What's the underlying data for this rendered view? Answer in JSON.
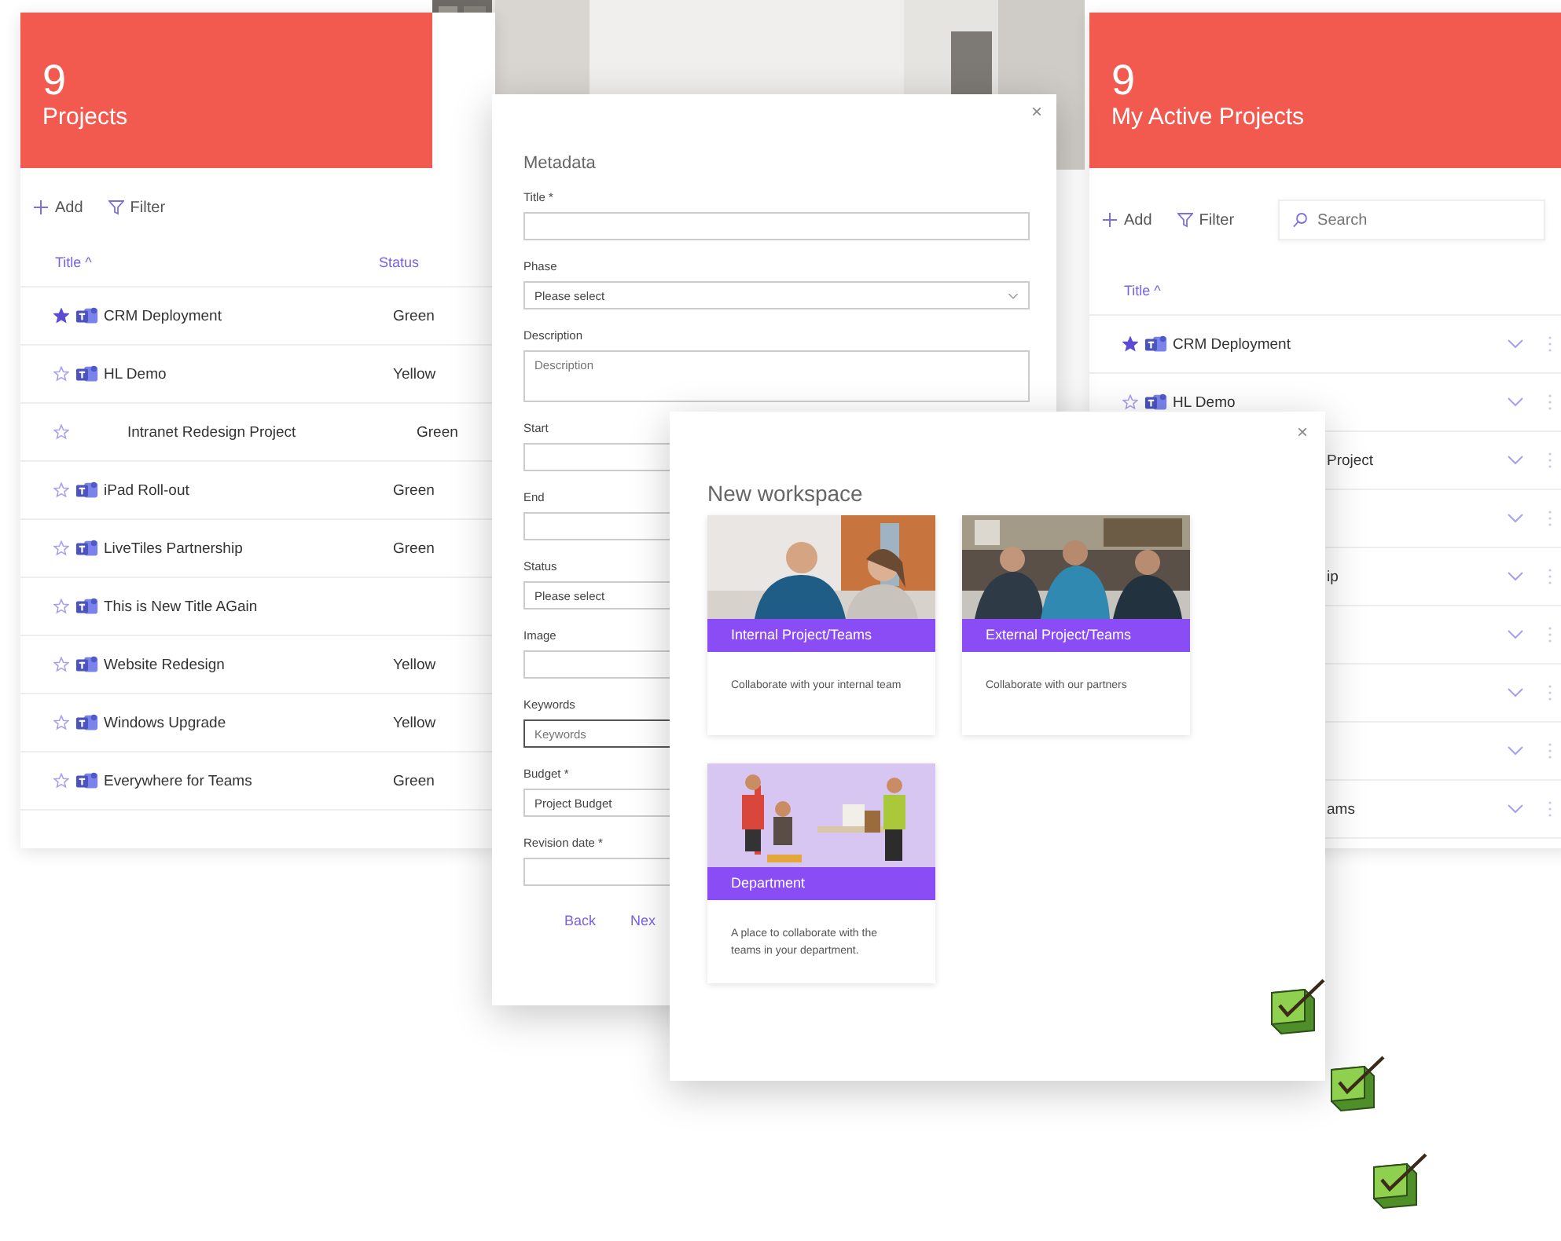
{
  "projects_panel": {
    "count": "9",
    "title": "Projects",
    "toolbar": [
      {
        "kind": "add",
        "label": "Add"
      },
      {
        "kind": "filter",
        "label": "Filter"
      }
    ],
    "columns": [
      "Title ^",
      "Status"
    ],
    "rows": [
      {
        "favorite": true,
        "teams": true,
        "title": "CRM Deployment",
        "status": "Green"
      },
      {
        "favorite": false,
        "teams": true,
        "title": "HL Demo",
        "status": "Yellow"
      },
      {
        "favorite": false,
        "teams": false,
        "title": "Intranet Redesign Project",
        "status": "Green"
      },
      {
        "favorite": false,
        "teams": true,
        "title": "iPad Roll-out",
        "status": "Green"
      },
      {
        "favorite": false,
        "teams": true,
        "title": "LiveTiles Partnership",
        "status": "Green"
      },
      {
        "favorite": false,
        "teams": true,
        "title": "This is New Title AGain"
      },
      {
        "favorite": false,
        "teams": true,
        "title": "Website Redesign",
        "status": "Yellow"
      },
      {
        "favorite": false,
        "teams": true,
        "title": "Windows Upgrade",
        "status": "Yellow"
      },
      {
        "favorite": false,
        "teams": true,
        "title": "Everywhere for Teams",
        "status": "Green"
      }
    ]
  },
  "active_panel": {
    "count": "9",
    "title": "My Active Projects",
    "toolbar": [
      {
        "kind": "add",
        "label": "Add"
      },
      {
        "kind": "filter",
        "label": "Filter"
      }
    ],
    "search": {
      "placeholder": "Search"
    },
    "columns": [
      "Title ^"
    ],
    "rows": [
      {
        "favorite": true,
        "teams": true,
        "title": "CRM Deployment",
        "expanded": false
      },
      {
        "favorite": false,
        "teams": true,
        "title": "HL Demo",
        "expanded": false
      },
      {
        "tail": "Project",
        "expanded": false
      },
      {
        "expanded": false
      },
      {
        "tail": "ip",
        "expanded": false
      },
      {
        "expanded": false
      },
      {
        "expanded": false
      },
      {
        "expanded": false
      },
      {
        "tail": "ams",
        "expanded": false
      }
    ]
  },
  "metadata_dialog": {
    "close": "×",
    "title": "Metadata",
    "fields": [
      {
        "kind": "text",
        "label": "Title *",
        "focused": false
      },
      {
        "kind": "select",
        "label": "Phase",
        "value": "Please select",
        "focused": false
      },
      {
        "kind": "textarea",
        "label": "Description",
        "placeholder": "Description",
        "focused": false
      },
      {
        "kind": "text",
        "label": "Start",
        "focused": false
      },
      {
        "kind": "text",
        "label": "End",
        "focused": false
      },
      {
        "kind": "select",
        "label": "Status",
        "value": "Please select",
        "focused": false
      },
      {
        "kind": "text",
        "label": "Image",
        "focused": false
      },
      {
        "kind": "text",
        "label": "Keywords",
        "placeholder": "Keywords",
        "focused": true
      },
      {
        "kind": "text",
        "label": "Budget *",
        "value": "Project Budget",
        "focused": false
      },
      {
        "kind": "text",
        "label": "Revision date *",
        "focused": false
      }
    ],
    "buttons": [
      "Back",
      "Nex"
    ]
  },
  "workspace_dialog": {
    "close": "×",
    "title": "New workspace",
    "cards": [
      {
        "title": "Internal Project/Teams",
        "description": "Collaborate with your internal team"
      },
      {
        "title": "External Project/Teams",
        "description": "Collaborate with our partners"
      },
      {
        "title": "Department",
        "description": "A place to collaborate with the teams in your department."
      }
    ]
  }
}
